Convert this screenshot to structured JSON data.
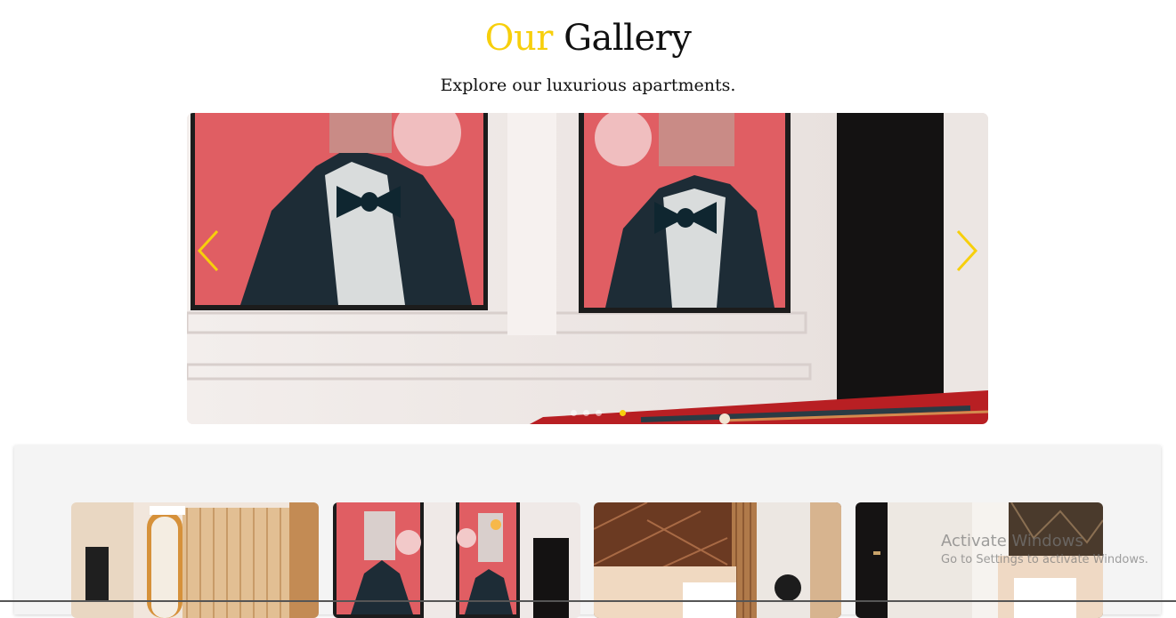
{
  "header": {
    "title_accent": "Our",
    "title_rest": "Gallery",
    "subtitle": "Explore our luxurious apartments."
  },
  "colors": {
    "accent": "#f7cf0c",
    "text": "#111111",
    "panel_bg": "#f4f4f4"
  },
  "slider": {
    "prev_icon": "chevron-left-icon",
    "next_icon": "chevron-right-icon",
    "image": "hallway-with-two-framed-portraits-and-pool-table",
    "dot_count": 4,
    "active_dot": 3
  },
  "thumbnails": [
    {
      "name": "bedroom-with-curtains-and-tv"
    },
    {
      "name": "framed-portraits-wall"
    },
    {
      "name": "bedroom-with-wood-panels"
    },
    {
      "name": "room-with-black-door-and-bed"
    }
  ],
  "watermark": {
    "line1": "Activate Windows",
    "line2": "Go to Settings to activate Windows."
  }
}
